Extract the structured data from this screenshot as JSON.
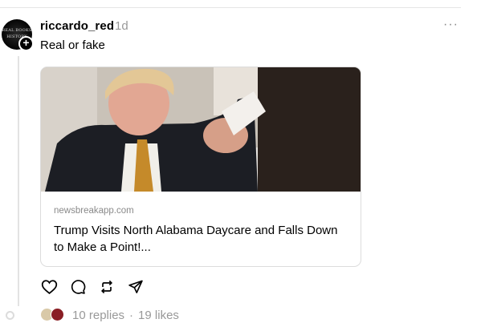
{
  "post": {
    "username": "riccardo_red",
    "timestamp": "1d",
    "more_label": "···",
    "text": "Real or fake",
    "avatar_text": [
      "REAL BOOKS",
      "HISTORY"
    ]
  },
  "link_card": {
    "domain": "newsbreakapp.com",
    "headline": "Trump Visits North Alabama Daycare and Falls Down to Make a Point!..."
  },
  "actions": {
    "icons": [
      "heart-icon",
      "comment-icon",
      "repost-icon",
      "share-icon"
    ]
  },
  "stats": {
    "replies": "10 replies",
    "separator": "·",
    "likes": "19 likes"
  },
  "colors": {
    "text": "#000000",
    "secondary": "#999999",
    "border": "#dcdcdc"
  }
}
